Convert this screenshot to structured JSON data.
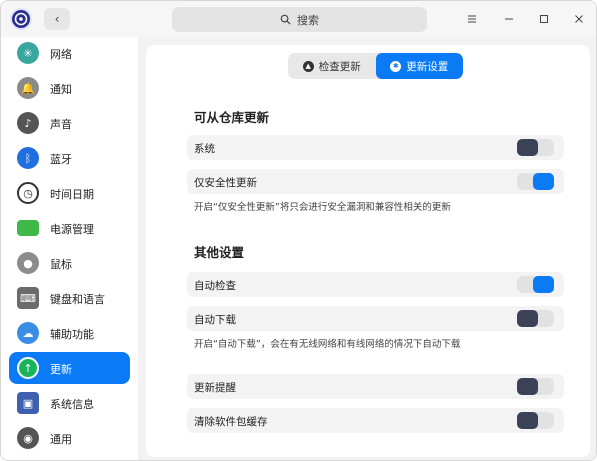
{
  "titlebar": {
    "search_label": "搜索",
    "back_icon": "chevron-left-icon",
    "menu_icon": "menu-icon",
    "minimize_icon": "minimize-icon",
    "maximize_icon": "maximize-icon",
    "close_icon": "close-icon"
  },
  "sidebar": {
    "items": [
      {
        "label": "网络",
        "icon": "network-icon",
        "color": "#3aa6a0"
      },
      {
        "label": "通知",
        "icon": "bell-icon",
        "color": "#8a8a8a"
      },
      {
        "label": "声音",
        "icon": "speaker-icon",
        "color": "#555555"
      },
      {
        "label": "蓝牙",
        "icon": "bluetooth-icon",
        "color": "#1f6fe0"
      },
      {
        "label": "时间日期",
        "icon": "clock-icon",
        "color": "#d9d9d9"
      },
      {
        "label": "电源管理",
        "icon": "battery-icon",
        "color": "#3fb84a"
      },
      {
        "label": "鼠标",
        "icon": "mouse-icon",
        "color": "#8c8c8c"
      },
      {
        "label": "键盘和语言",
        "icon": "keyboard-icon",
        "color": "#6b6b6b"
      },
      {
        "label": "辅助功能",
        "icon": "accessibility-icon",
        "color": "#3a8ee6"
      },
      {
        "label": "更新",
        "icon": "update-icon",
        "color": "#19b35b"
      },
      {
        "label": "系统信息",
        "icon": "system-info-icon",
        "color": "#3f5fb0"
      },
      {
        "label": "通用",
        "icon": "general-icon",
        "color": "#555555"
      }
    ],
    "active_index": 9
  },
  "tabs": {
    "check_label": "检查更新",
    "settings_label": "更新设置",
    "active": "settings"
  },
  "repo_section": {
    "title": "可从仓库更新",
    "rows": [
      {
        "label": "系统",
        "enabled": false
      },
      {
        "label": "仅安全性更新",
        "enabled": true
      }
    ],
    "hint": "开启“仅安全性更新”将只会进行安全漏洞和兼容性相关的更新"
  },
  "other_section": {
    "title": "其他设置",
    "rows": [
      {
        "label": "自动检查",
        "enabled": true
      },
      {
        "label": "自动下载",
        "enabled": false
      }
    ],
    "hint": "开启“自动下载”，会在有无线网络和有线网络的情况下自动下载"
  },
  "extra_rows": [
    {
      "label": "更新提醒",
      "enabled": false
    },
    {
      "label": "清除软件包缓存",
      "enabled": false
    }
  ],
  "colors": {
    "accent": "#0a7bf5",
    "toggle_off_knob": "#3b4257"
  }
}
